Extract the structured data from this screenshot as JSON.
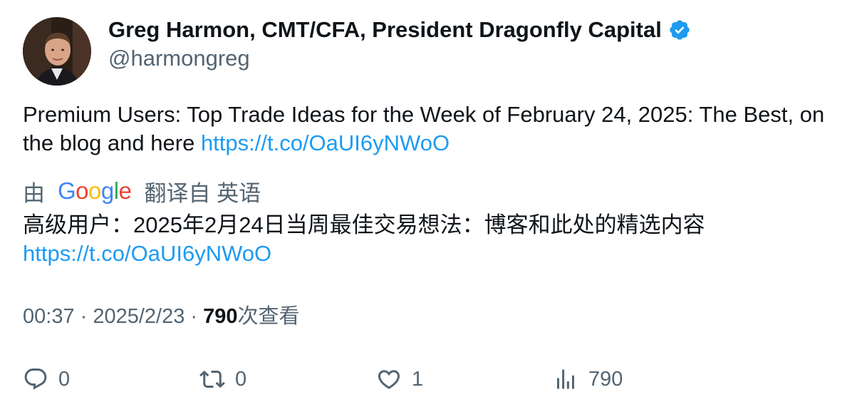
{
  "author": {
    "display_name": "Greg Harmon, CMT/CFA, President Dragonfly Capital",
    "handle": "@harmongreg",
    "avatar_icon": "avatar-photo",
    "verified_icon": "verified-badge-icon",
    "verified_color": "#1d9bf0"
  },
  "tweet": {
    "text": "Premium Users: Top Trade Ideas for the Week of February 24, 2025: The Best, on the blog and here ",
    "link": "https://t.co/OaUI6yNWoO"
  },
  "translation": {
    "prefix": "由",
    "provider": "Google",
    "suffix": "翻译自 英语",
    "text": "高级用户：2025年2月24日当周最佳交易想法：博客和此处的精选内容",
    "link": "https://t.co/OaUI6yNWoO"
  },
  "meta": {
    "time": "00:37",
    "separator": " · ",
    "date": "2025/2/23",
    "views_count": "790",
    "views_label": "次查看"
  },
  "actions": {
    "reply_count": "0",
    "retweet_count": "0",
    "like_count": "1",
    "views_count": "790"
  },
  "colors": {
    "text_primary": "#0f1419",
    "text_secondary": "#536471",
    "link": "#1d9bf0"
  }
}
